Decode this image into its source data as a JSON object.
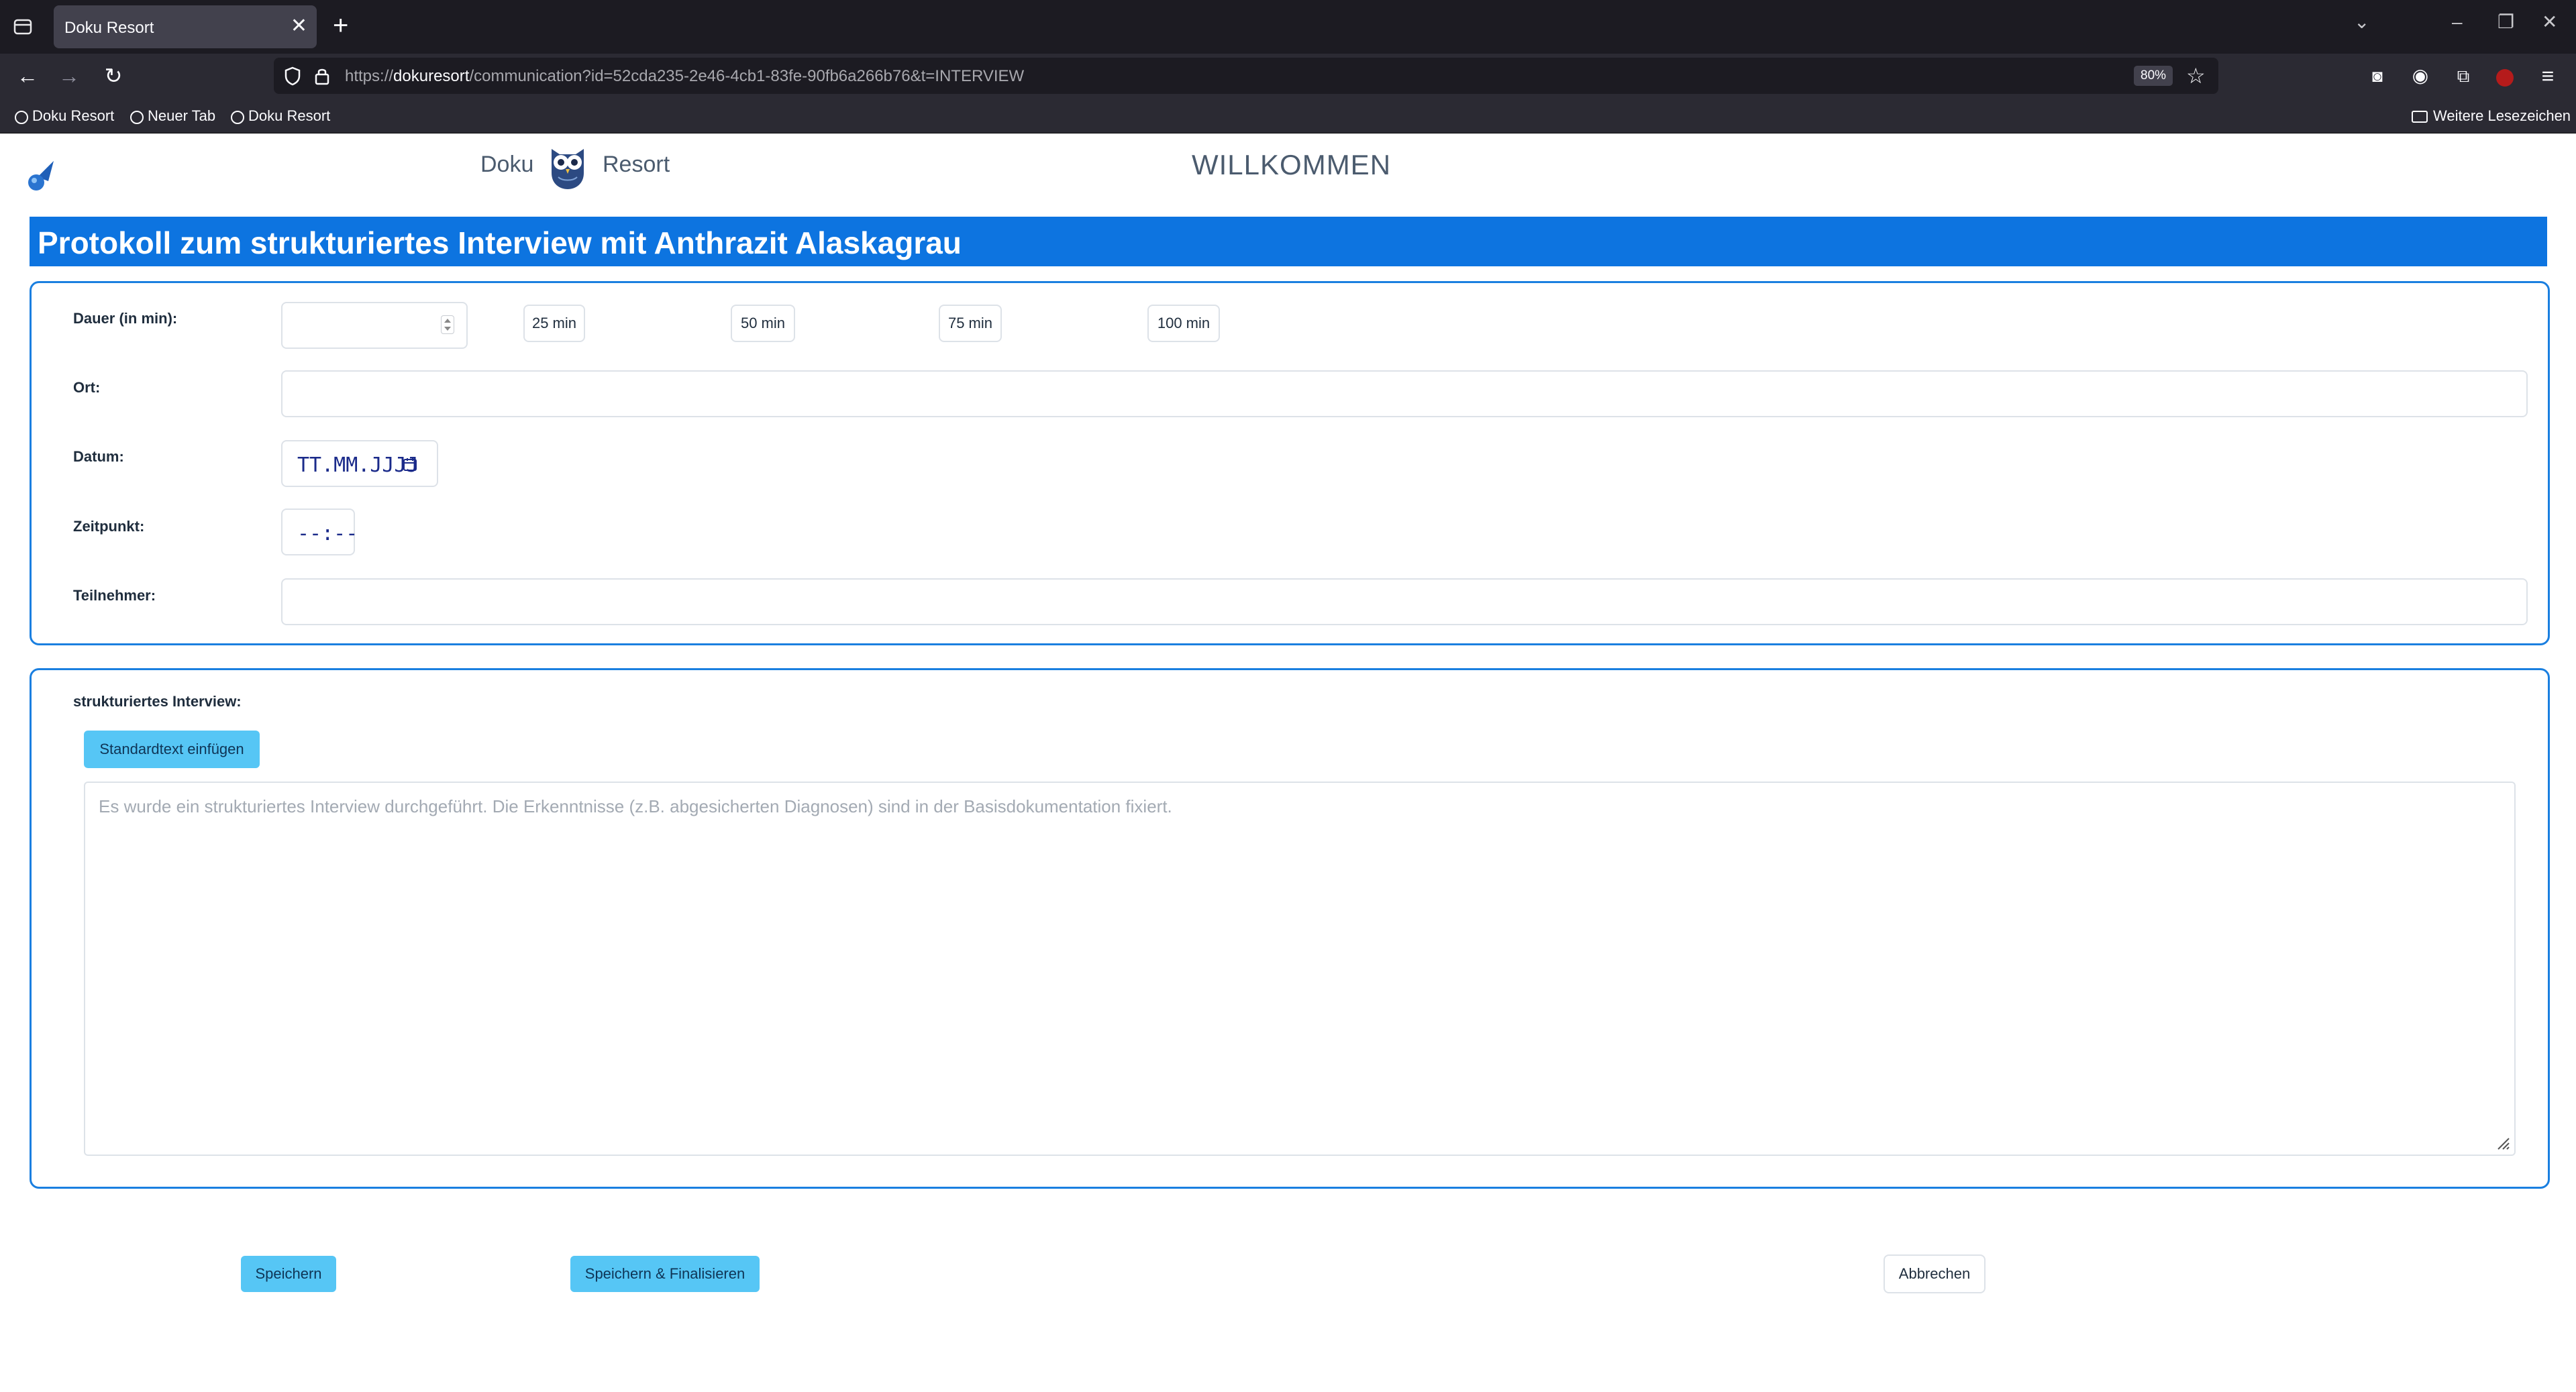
{
  "browser": {
    "tab_title": "Doku Resort",
    "url_prefix": "https://",
    "url_domain": "dokuresort",
    "url_rest": "/communication?id=52cda235-2e46-4cb1-83fe-90fb6a266b76&t=INTERVIEW",
    "zoom": "80%",
    "bookmarks": [
      "Doku Resort",
      "Neuer Tab",
      "Doku Resort"
    ],
    "other_bookmarks": "Weitere Lesezeichen"
  },
  "header": {
    "brand_left": "Doku",
    "brand_right": "Resort",
    "welcome": "WILLKOMMEN"
  },
  "banner_title": "Protokoll zum strukturiertes Interview mit Anthrazit Alaskagrau",
  "form": {
    "duration": {
      "label": "Dauer (in min):",
      "value": "",
      "presets": [
        "25 min",
        "50 min",
        "75 min",
        "100 min"
      ]
    },
    "location": {
      "label": "Ort:",
      "value": ""
    },
    "date": {
      "label": "Datum:",
      "placeholder": "TT.MM.JJJJ"
    },
    "time": {
      "label": "Zeitpunkt:",
      "placeholder": "--:--"
    },
    "participants": {
      "label": "Teilnehmer:",
      "value": ""
    }
  },
  "interview": {
    "label": "strukturiertes Interview:",
    "insert_button": "Standardtext einfügen",
    "placeholder": "Es wurde ein strukturiertes Interview durchgeführt. Die Erkenntnisse (z.B. abgesicherten Diagnosen) sind in der Basisdokumentation fixiert."
  },
  "actions": {
    "save": "Speichern",
    "save_finalize": "Speichern & Finalisieren",
    "cancel": "Abbrechen"
  },
  "colors": {
    "banner": "#0d74e0",
    "card_border": "#1a7fe0",
    "info_button": "#56c6f5"
  }
}
